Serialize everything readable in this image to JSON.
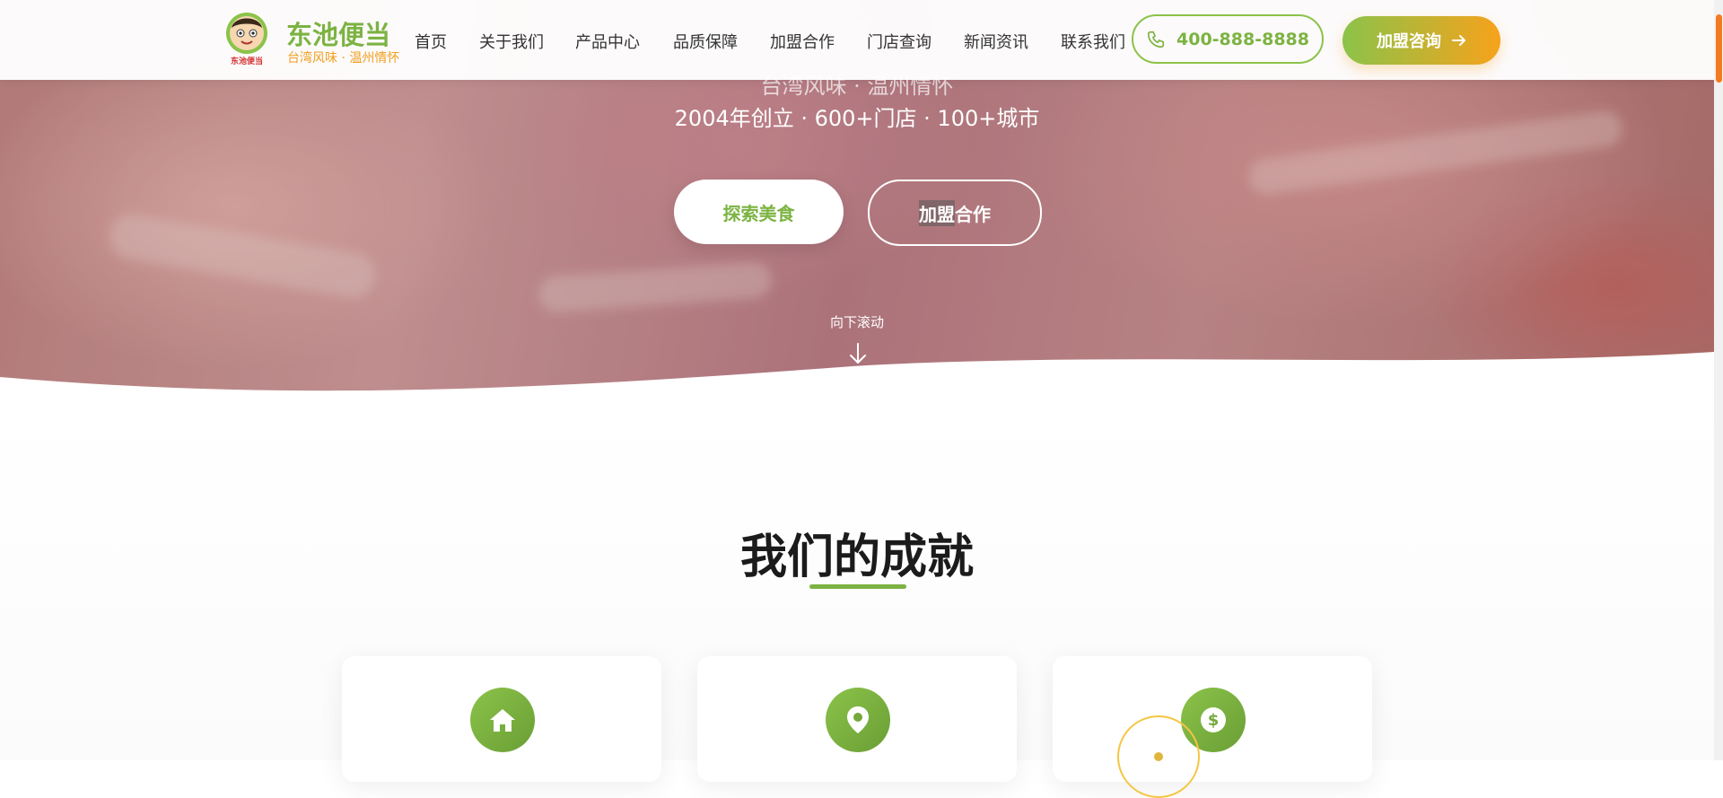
{
  "header": {
    "brand_name": "东池便当",
    "brand_slogan": "台湾风味 · 温州情怀",
    "logo_text": "东池便当",
    "nav": [
      "首页",
      "关于我们",
      "产品中心",
      "品质保障",
      "加盟合作",
      "门店查询",
      "新闻资讯",
      "联系我们"
    ],
    "phone": "400-888-8888",
    "consult_label": "加盟咨询"
  },
  "hero": {
    "tagline": "台湾风味 · 温州情怀",
    "stats_line": "2004年创立 · 600+门店 · 100+城市",
    "explore_label": "探索美食",
    "join_label_part1": "加盟",
    "join_label_part2": "合作",
    "scroll_hint": "向下滚动"
  },
  "achievements": {
    "title": "我们的成就",
    "cards": [
      {
        "icon": "home-icon"
      },
      {
        "icon": "location-pin-icon"
      },
      {
        "icon": "dollar-icon"
      }
    ]
  },
  "colors": {
    "brand_green": "#7cb342",
    "brand_orange": "#f7a21b",
    "scroll_thumb": "#f47a20"
  }
}
